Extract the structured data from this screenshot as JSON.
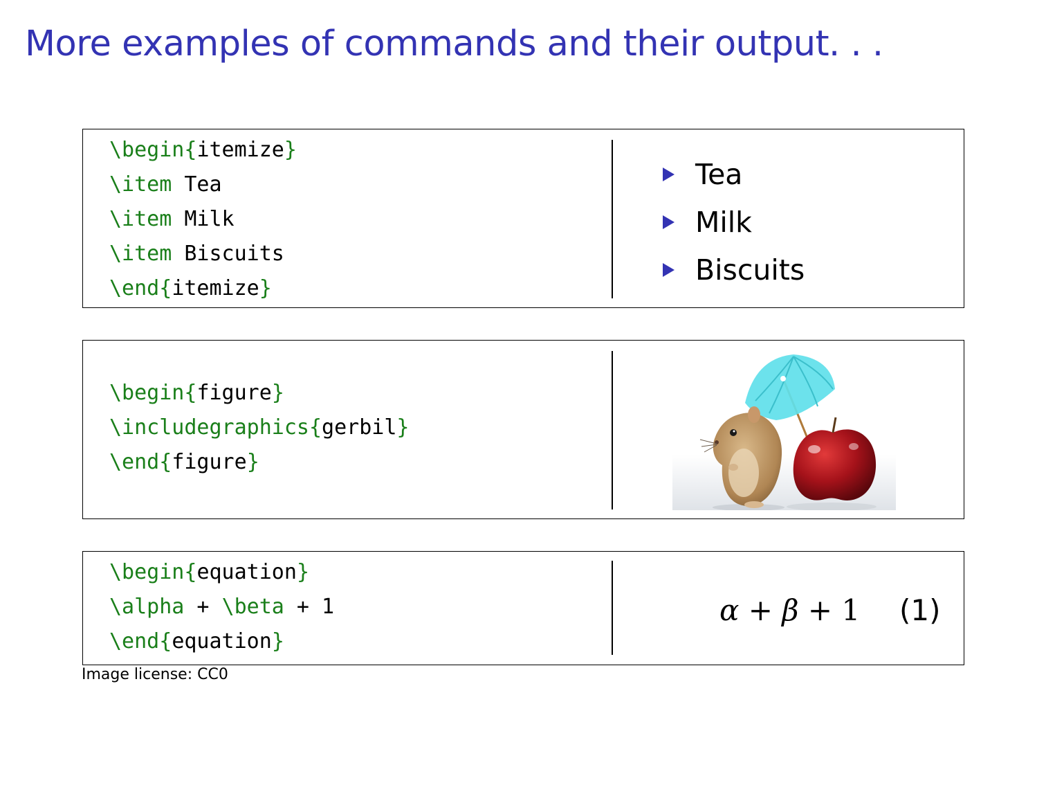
{
  "slide": {
    "title": "More examples of commands and their output. . ."
  },
  "itemize_example": {
    "code_lines": [
      {
        "kw1": "\\begin{",
        "arg": "itemize",
        "kw2": "}"
      },
      {
        "kw1": "\\item",
        "arg": " Tea",
        "kw2": ""
      },
      {
        "kw1": "\\item",
        "arg": " Milk",
        "kw2": ""
      },
      {
        "kw1": "\\item",
        "arg": " Biscuits",
        "kw2": ""
      },
      {
        "kw1": "\\end{",
        "arg": "itemize",
        "kw2": "}"
      }
    ],
    "output_items": [
      "Tea",
      "Milk",
      "Biscuits"
    ]
  },
  "figure_example": {
    "code_lines": [
      {
        "kw1": "\\begin{",
        "arg": "figure",
        "kw2": "}"
      },
      {
        "kw1": "\\includegraphics{",
        "arg": "gerbil",
        "kw2": "}"
      },
      {
        "kw1": "\\end{",
        "arg": "figure",
        "kw2": "}"
      }
    ],
    "image_icon": "gerbil-with-apple-and-umbrella-image"
  },
  "equation_example": {
    "code_lines": [
      {
        "kw1": "\\begin{",
        "arg": "equation",
        "kw2": "}"
      },
      {
        "kw1": "\\alpha",
        "arg": " + ",
        "kw2": "\\beta",
        "tail": " + 1"
      },
      {
        "kw1": "\\end{",
        "arg": "equation",
        "kw2": "}"
      }
    ],
    "output": {
      "alpha": "α",
      "plus1": " + ",
      "beta": "β",
      "plus2": " + ",
      "one": "1",
      "number": "(1)"
    }
  },
  "caption": "Image license: CC0",
  "colors": {
    "title": "#3333b3",
    "keyword": "#1a7f1a",
    "bullet": "#3333b3"
  }
}
